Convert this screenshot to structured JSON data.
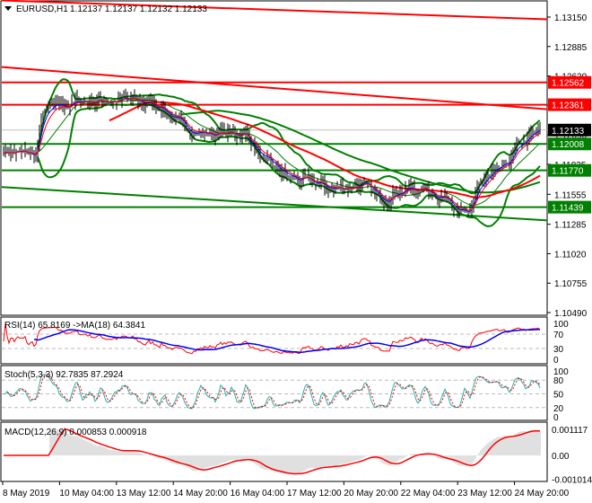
{
  "header": {
    "symbol": "EURUSD,H1",
    "ohlc": "1.12137 1.12137 1.12132 1.12133"
  },
  "colors": {
    "bars": "#000000",
    "resistance": "#ff0000",
    "support": "#008000",
    "current": "#000000",
    "ma_fast": "#0000ff",
    "ma_slow": "#ff0000",
    "stoch_k": "#20b2aa"
  },
  "chart_data": {
    "type": "line",
    "title": "EURUSD,H1",
    "bars": 300,
    "close_waypoints": [
      [
        0,
        1.1195
      ],
      [
        18,
        1.119
      ],
      [
        22,
        1.123
      ],
      [
        45,
        1.124
      ],
      [
        70,
        1.124
      ],
      [
        88,
        1.1235
      ],
      [
        100,
        1.1215
      ],
      [
        115,
        1.121
      ],
      [
        135,
        1.121
      ],
      [
        145,
        1.1185
      ],
      [
        160,
        1.117
      ],
      [
        185,
        1.116
      ],
      [
        200,
        1.1165
      ],
      [
        210,
        1.115
      ],
      [
        220,
        1.116
      ],
      [
        235,
        1.116
      ],
      [
        250,
        1.115
      ],
      [
        260,
        1.1135
      ],
      [
        265,
        1.1165
      ],
      [
        280,
        1.118
      ],
      [
        288,
        1.12
      ],
      [
        299,
        1.12133
      ]
    ],
    "ylim": [
      1.1049,
      1.1315
    ],
    "y_ticks": [
      "1.13150",
      "1.12885",
      "1.12620",
      "1.12355",
      "1.12090",
      "1.11825",
      "1.11555",
      "1.11285",
      "1.11020",
      "1.10755",
      "1.10490"
    ],
    "levels": [
      {
        "price": 1.12562,
        "label": "1.12562",
        "kind": "resistance"
      },
      {
        "price": 1.12361,
        "label": "1.12361",
        "kind": "resistance"
      },
      {
        "price": 1.12133,
        "label": "1.12133",
        "kind": "current"
      },
      {
        "price": 1.12008,
        "label": "1.12008",
        "kind": "support"
      },
      {
        "price": 1.1177,
        "label": "1.11770",
        "kind": "support"
      },
      {
        "price": 1.11439,
        "label": "1.11439",
        "kind": "support"
      }
    ],
    "trendlines": [
      {
        "from": 1.133,
        "to": 1.1313,
        "kind": "resistance"
      },
      {
        "from": 1.127,
        "to": 1.1232,
        "kind": "resistance"
      },
      {
        "from": 1.1162,
        "to": 1.1132,
        "kind": "support"
      }
    ],
    "x_ticks": [
      "8 May 2019",
      "10 May 04:00",
      "13 May 12:00",
      "14 May 20:00",
      "16 May 04:00",
      "17 May 12:00",
      "20 May 20:00",
      "22 May 04:00",
      "23 May 12:00",
      "24 May 20:00"
    ],
    "rsi": {
      "label": "RSI(14) 65.8169  ->MA(18) 64.3841",
      "ticks": [
        "100",
        "70",
        "30",
        "0"
      ]
    },
    "stoch": {
      "label": "Stoch(5,3,3) 92.7835 87.2924",
      "ticks": [
        "100",
        "80",
        "50",
        "20",
        "0"
      ]
    },
    "macd": {
      "label": "MACD(12,26,9) 0.000853 0.000918",
      "ticks": [
        "0.001117",
        "0.00",
        "-0.001014"
      ],
      "range": [
        -0.001014,
        0.001117
      ]
    }
  }
}
